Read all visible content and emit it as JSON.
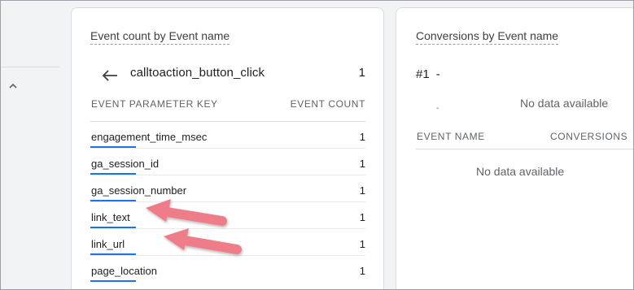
{
  "left_panel": {
    "collapse_icon": "chevron-up-icon"
  },
  "event_card": {
    "title": "Event count by Event name",
    "selected_event": {
      "name": "calltoaction_button_click",
      "count": "1",
      "back_icon": "arrow-left-icon"
    },
    "columns": {
      "key": "EVENT PARAMETER KEY",
      "count": "EVENT COUNT"
    },
    "rows": [
      {
        "key": "engagement_time_msec",
        "count": "1"
      },
      {
        "key": "ga_session_id",
        "count": "1"
      },
      {
        "key": "ga_session_number",
        "count": "1"
      },
      {
        "key": "link_text",
        "count": "1"
      },
      {
        "key": "link_url",
        "count": "1"
      },
      {
        "key": "page_location",
        "count": "1"
      }
    ]
  },
  "conversions_card": {
    "title": "Conversions by Event name",
    "rank": "#1",
    "rank_value": "-",
    "small_dash": "-",
    "no_data_top": "No data available",
    "columns": {
      "name": "EVENT NAME",
      "conversions": "CONVERSIONS"
    },
    "no_data_bottom": "No data available"
  },
  "annotations": {
    "arrow_color": "#ef7b89",
    "targets": [
      "link_text",
      "link_url"
    ]
  },
  "colors": {
    "accent": "#1a73e8",
    "muted_text": "#5f6368",
    "background": "#f1f3f4"
  }
}
